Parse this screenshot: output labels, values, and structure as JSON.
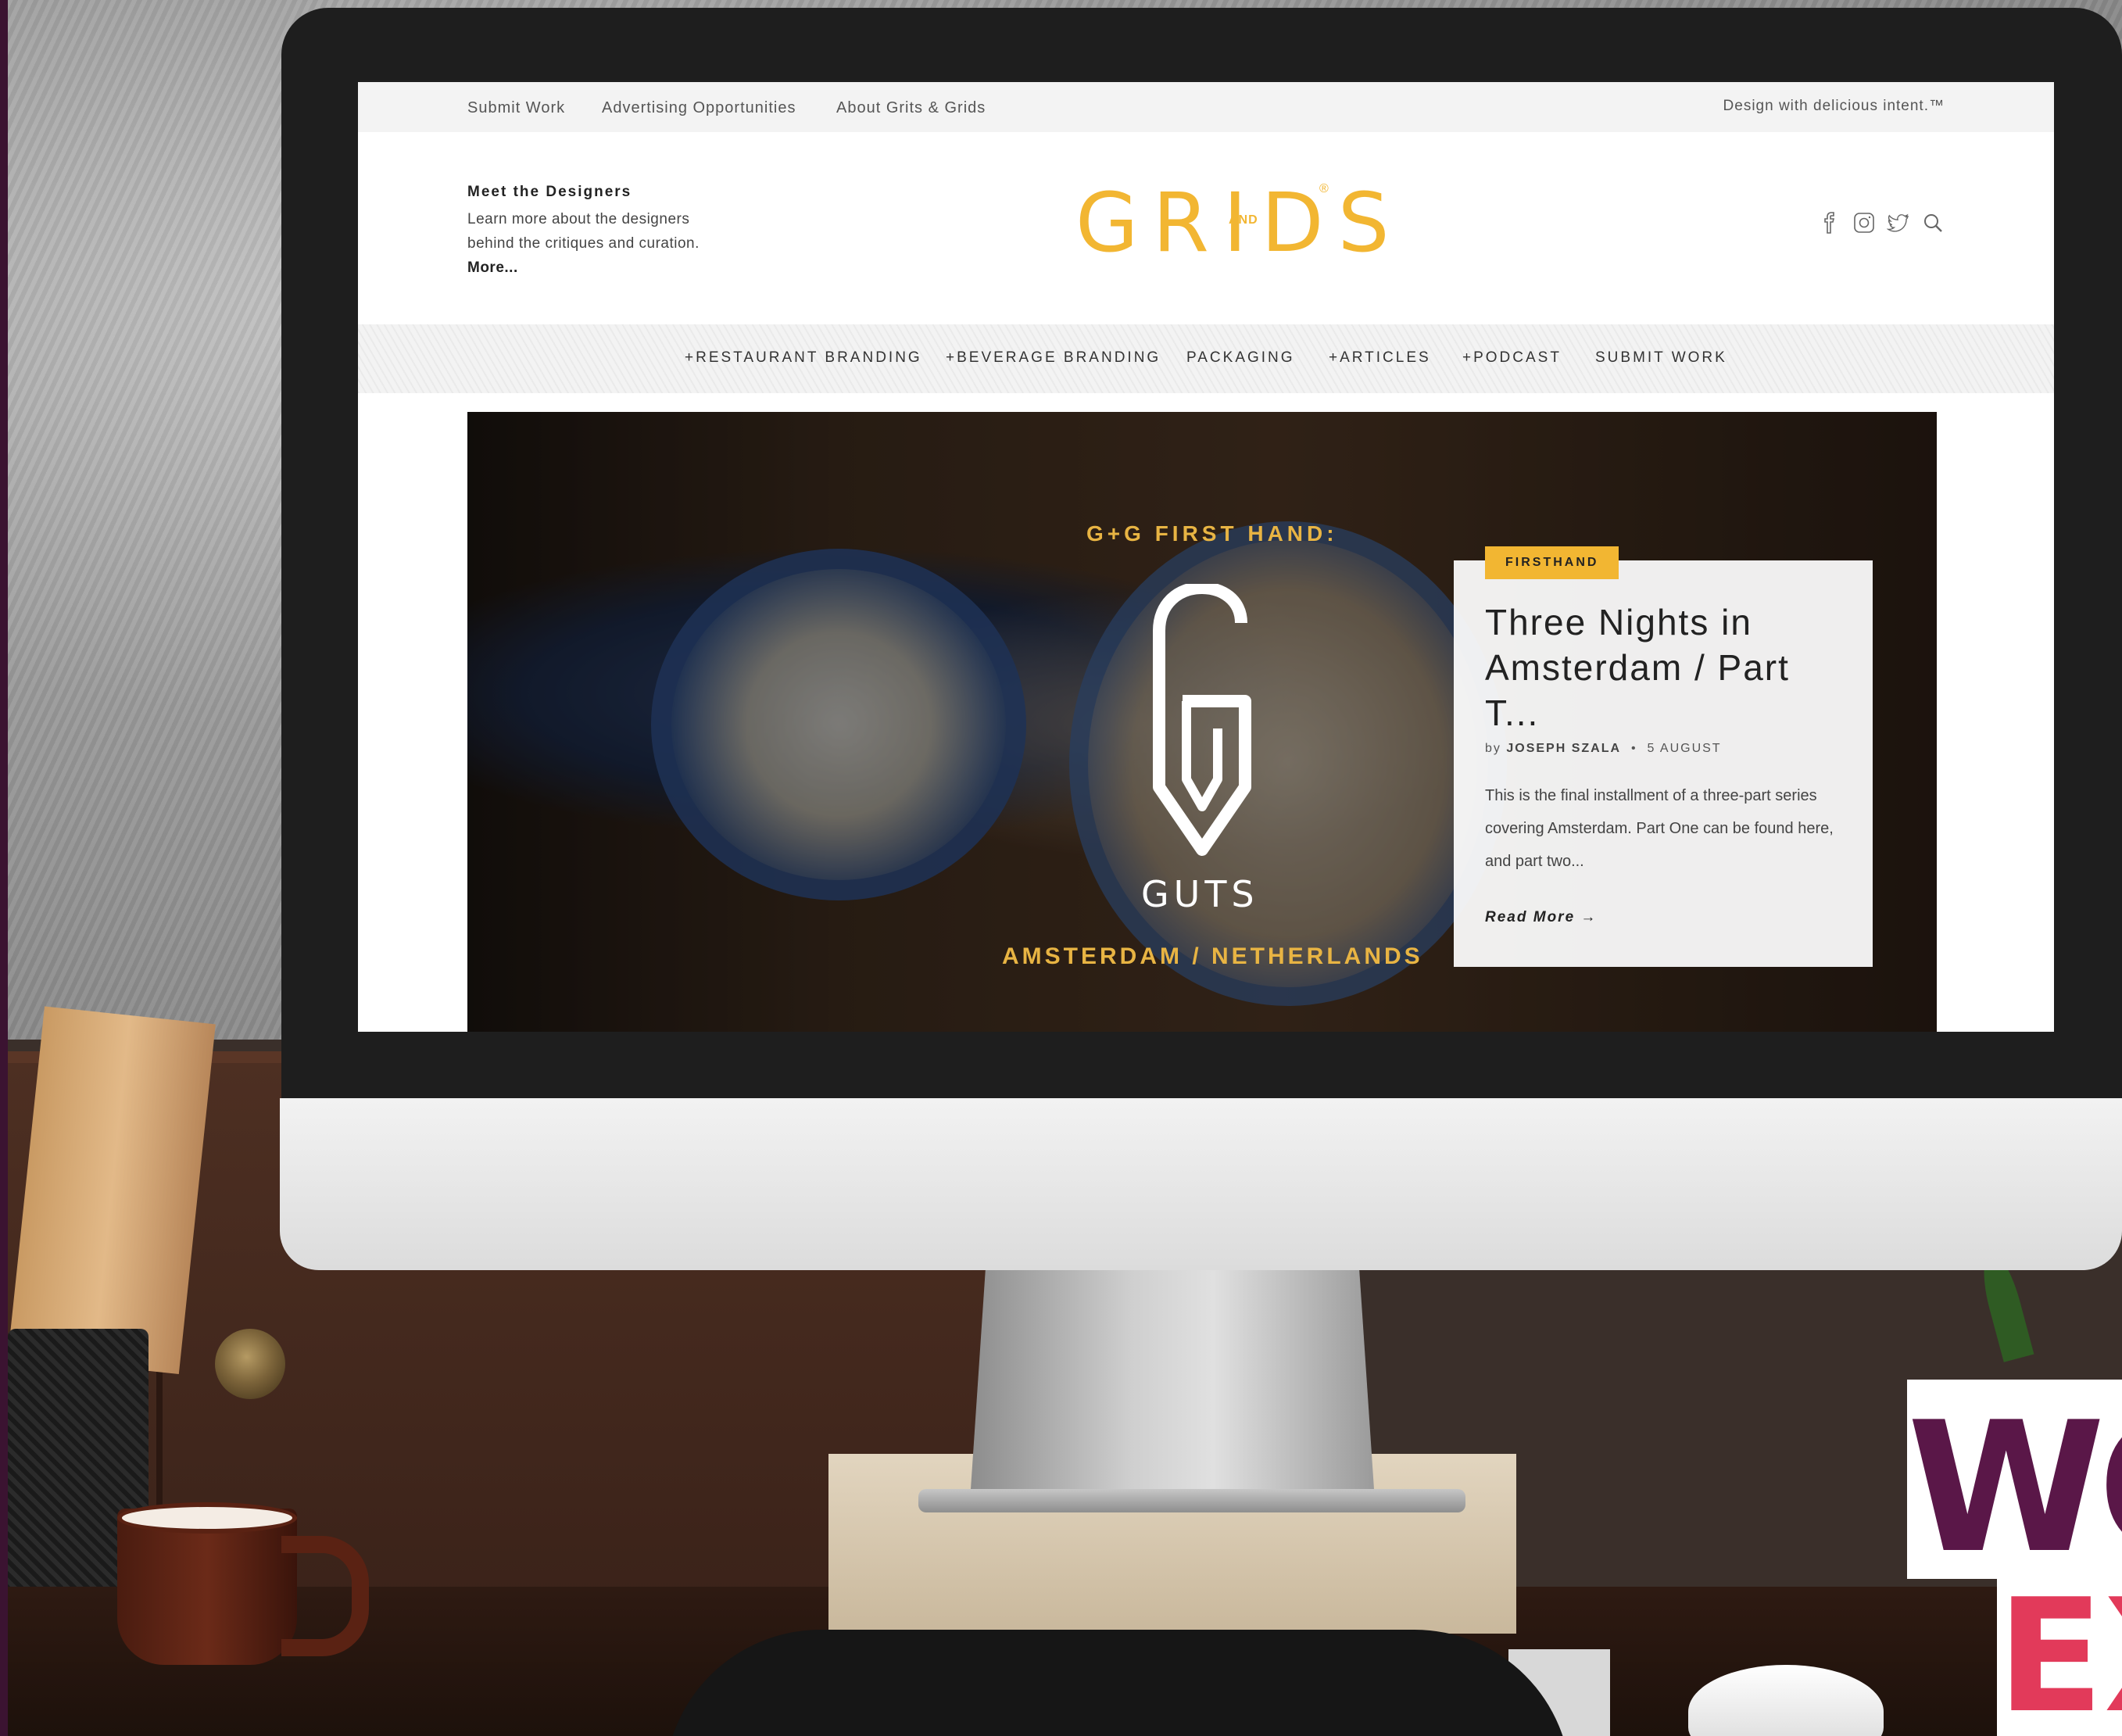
{
  "topbar": {
    "links": [
      "Submit Work",
      "Advertising Opportunities",
      "About Grits & Grids"
    ],
    "tagline": "Design with delicious intent.™"
  },
  "intro": {
    "title": "Meet the Designers",
    "text": "Learn more about the designers behind the critiques and curation.",
    "more": "More..."
  },
  "logo": {
    "word": "GRIDS",
    "and": "AND",
    "reg": "®",
    "color": "#f2b632"
  },
  "social": [
    "facebook-icon",
    "instagram-icon",
    "twitter-icon",
    "search-icon"
  ],
  "nav": [
    "+RESTAURANT BRANDING",
    "+BEVERAGE BRANDING",
    "PACKAGING",
    "+ARTICLES",
    "+PODCAST",
    "SUBMIT WORK"
  ],
  "hero": {
    "kicker": "G+G FIRST HAND:",
    "brand": "GUTS",
    "location": "AMSTERDAM / NETHERLANDS"
  },
  "card": {
    "badge": "FIRSTHAND",
    "title": "Three Nights in Amsterdam / Part T...",
    "by": "by",
    "author": "JOSEPH SZALA",
    "separator": "•",
    "date": "5 AUGUST",
    "excerpt": "This is the final installment of a three-part series covering Amsterdam. Part One can be found here, and part two...",
    "read_more": "Read More →"
  },
  "watermark": {
    "line1": "WO",
    "line2": "EX"
  },
  "colors": {
    "accent": "#f2b632",
    "watermark_purple": "#5a1748",
    "watermark_pink": "#e23a5a"
  }
}
